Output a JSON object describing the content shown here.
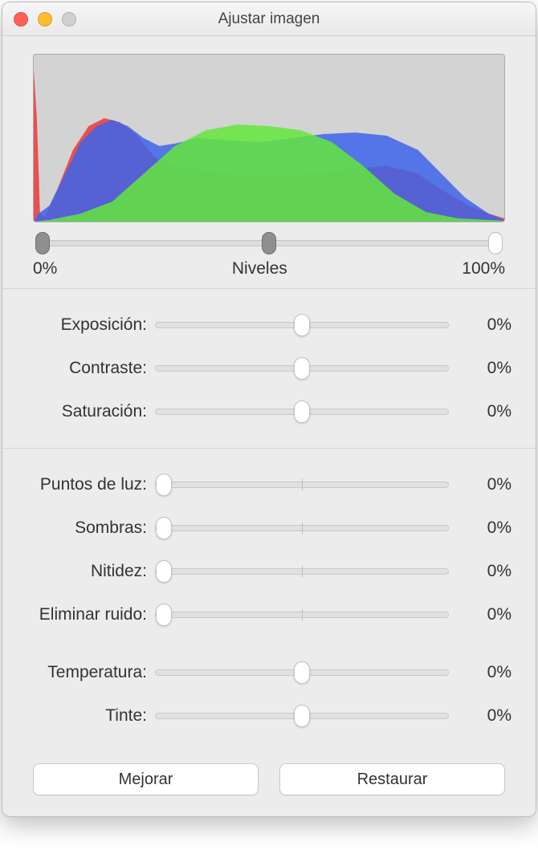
{
  "window": {
    "title": "Ajustar imagen"
  },
  "levels": {
    "left_label": "0%",
    "mid_label": "Niveles",
    "right_label": "100%",
    "black_point": 0,
    "mid_point": 50,
    "white_point": 100
  },
  "sliders": {
    "group1": [
      {
        "label": "Exposición:",
        "value": "0%",
        "pos": 50,
        "tick": true
      },
      {
        "label": "Contraste:",
        "value": "0%",
        "pos": 50,
        "tick": true
      },
      {
        "label": "Saturación:",
        "value": "0%",
        "pos": 50,
        "tick": true
      }
    ],
    "group2": [
      {
        "label": "Puntos de luz:",
        "value": "0%",
        "pos": 0,
        "tick": true
      },
      {
        "label": "Sombras:",
        "value": "0%",
        "pos": 0,
        "tick": true
      },
      {
        "label": "Nitidez:",
        "value": "0%",
        "pos": 0,
        "tick": true
      },
      {
        "label": "Eliminar ruido:",
        "value": "0%",
        "pos": 0,
        "tick": true
      }
    ],
    "group3": [
      {
        "label": "Temperatura:",
        "value": "0%",
        "pos": 50,
        "tick": true
      },
      {
        "label": "Tinte:",
        "value": "0%",
        "pos": 50,
        "tick": true
      }
    ]
  },
  "buttons": {
    "enhance": "Mejorar",
    "reset": "Restaurar"
  }
}
